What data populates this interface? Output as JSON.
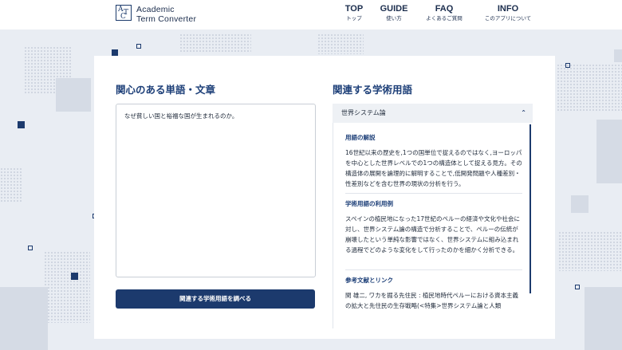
{
  "header": {
    "logo_letters": [
      "A",
      "T",
      "C"
    ],
    "logo_line1": "Academic",
    "logo_line2": "Term Converter",
    "nav": [
      {
        "en": "TOP",
        "ja": "トップ"
      },
      {
        "en": "GUIDE",
        "ja": "使い方"
      },
      {
        "en": "FAQ",
        "ja": "よくあるご質問"
      },
      {
        "en": "INFO",
        "ja": "このアプリについて"
      }
    ]
  },
  "left": {
    "title": "関心のある単語・文章",
    "input_value": "なぜ貧しい国と裕福な国が生まれるのか。",
    "button_label": "関連する学術用語を調べる"
  },
  "right": {
    "title": "関連する学術用語",
    "term": "世界システム論",
    "sections": [
      {
        "heading": "用語の解説",
        "body": "16世紀以来の歴史を,1つの国単位で捉えるのではなく,ヨーロッパを中心とした世界レベルでの1つの構造体として捉える見方。その構造体の展開を論理的に解明することで,低開発問題や人種差別・性差別などを含む世界の現状の分析を行う。"
      },
      {
        "heading": "学術用語の利用例",
        "body": "スペインの植民地になった17世紀のペルーの経済や文化や社会に対し、世界システム論の構造で分析することで、ペルーの伝統が崩壊したという単純な影響ではなく、世界システムに組み込まれる過程でどのような変化をして行ったのかを細かく分析できる。"
      },
      {
        "heading": "参考文献とリンク",
        "body": "関 雄二, ワカを掘る先住民 : 植民地時代ペルーにおける資本主義の拡大と先住民の生存戦略(<特集>世界システム論と人類"
      }
    ]
  },
  "colors": {
    "brand_navy": "#1c3a6d",
    "title_blue": "#1d3f78",
    "background": "#e9edf3"
  }
}
